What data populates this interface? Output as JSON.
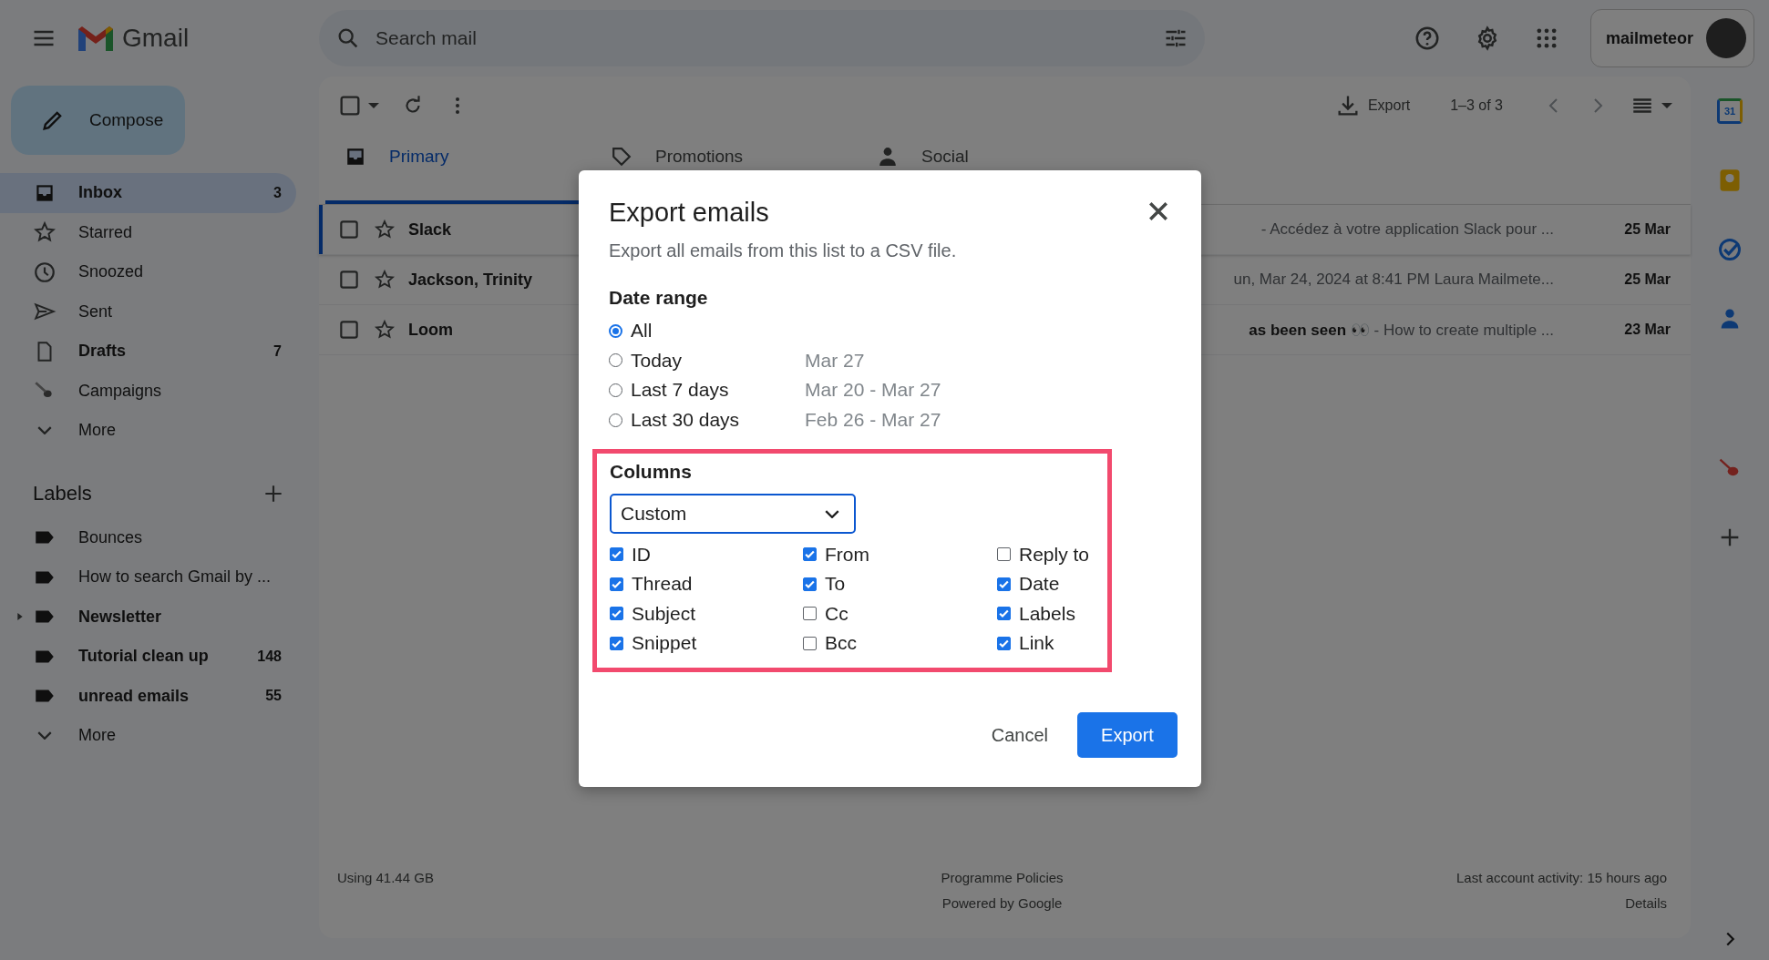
{
  "header": {
    "app_name": "Gmail",
    "search": {
      "placeholder": "Search mail"
    },
    "account": "mailmeteor"
  },
  "compose": "Compose",
  "sidebar": {
    "items": [
      {
        "label": "Inbox",
        "count": "3",
        "selected": true,
        "unread": true
      },
      {
        "label": "Starred",
        "selected": false,
        "unread": false
      },
      {
        "label": "Snoozed",
        "selected": false,
        "unread": false
      },
      {
        "label": "Sent",
        "selected": false,
        "unread": false
      },
      {
        "label": "Drafts",
        "count": "7",
        "selected": false,
        "unread": true
      },
      {
        "label": "Campaigns",
        "selected": false,
        "unread": false
      }
    ],
    "more": "More",
    "labels_heading": "Labels",
    "labels": [
      {
        "label": "Bounces",
        "unread": false,
        "expandable": false
      },
      {
        "label": "How to search Gmail by ...",
        "unread": false,
        "expandable": false
      },
      {
        "label": "Newsletter",
        "unread": true,
        "expandable": true
      },
      {
        "label": "Tutorial clean up",
        "count": "148",
        "unread": true,
        "expandable": false
      },
      {
        "label": "unread emails",
        "count": "55",
        "unread": true,
        "expandable": false
      }
    ],
    "labels_more": "More"
  },
  "toolbar": {
    "select_all_checked": false,
    "export": "Export",
    "pagination": "1–3 of 3"
  },
  "tabs": [
    {
      "label": "Primary",
      "selected": true
    },
    {
      "label": "Promotions",
      "selected": false
    },
    {
      "label": "Social",
      "selected": false
    }
  ],
  "emails": [
    {
      "sender": "Slack",
      "snippet": "- Accédez à votre application Slack pour ...",
      "date": "25 Mar",
      "unread": true,
      "focused": true
    },
    {
      "sender": "Jackson, Trinity",
      "snippet": "un, Mar 24, 2024 at 8:41 PM Laura Mailmete...",
      "date": "25 Mar",
      "unread": true,
      "focused": false
    },
    {
      "sender": "Loom",
      "snippet": "**as been seen 👀** - How to create multiple ...",
      "date": "23 Mar",
      "unread": true,
      "focused": false
    }
  ],
  "footer": {
    "storage": "Using 41.44 GB",
    "policies": "Programme Policies",
    "powered": "Powered by Google",
    "activity": "Last account activity: 15 hours ago",
    "details": "Details"
  },
  "side_panel": {
    "calendar_day": "31"
  },
  "dialog": {
    "title": "Export emails",
    "subtitle": "Export all emails from this list to a CSV file.",
    "date_range": {
      "heading": "Date range",
      "options": [
        {
          "label": "All",
          "selected": true
        },
        {
          "label": "Today",
          "dates": "Mar 27",
          "selected": false
        },
        {
          "label": "Last 7 days",
          "dates": "Mar 20 - Mar 27",
          "selected": false
        },
        {
          "label": "Last 30 days",
          "dates": "Feb 26 - Mar 27",
          "selected": false
        }
      ]
    },
    "columns": {
      "heading": "Columns",
      "highlighted": true,
      "preset": "Custom",
      "options": [
        {
          "label": "ID",
          "checked": true
        },
        {
          "label": "Thread",
          "checked": true
        },
        {
          "label": "Subject",
          "checked": true
        },
        {
          "label": "Snippet",
          "checked": true
        },
        {
          "label": "From",
          "checked": true
        },
        {
          "label": "To",
          "checked": true
        },
        {
          "label": "Cc",
          "checked": false
        },
        {
          "label": "Bcc",
          "checked": false
        },
        {
          "label": "Reply to",
          "checked": false
        },
        {
          "label": "Date",
          "checked": true
        },
        {
          "label": "Labels",
          "checked": true
        },
        {
          "label": "Link",
          "checked": true
        }
      ]
    },
    "cancel": "Cancel",
    "export": "Export"
  }
}
